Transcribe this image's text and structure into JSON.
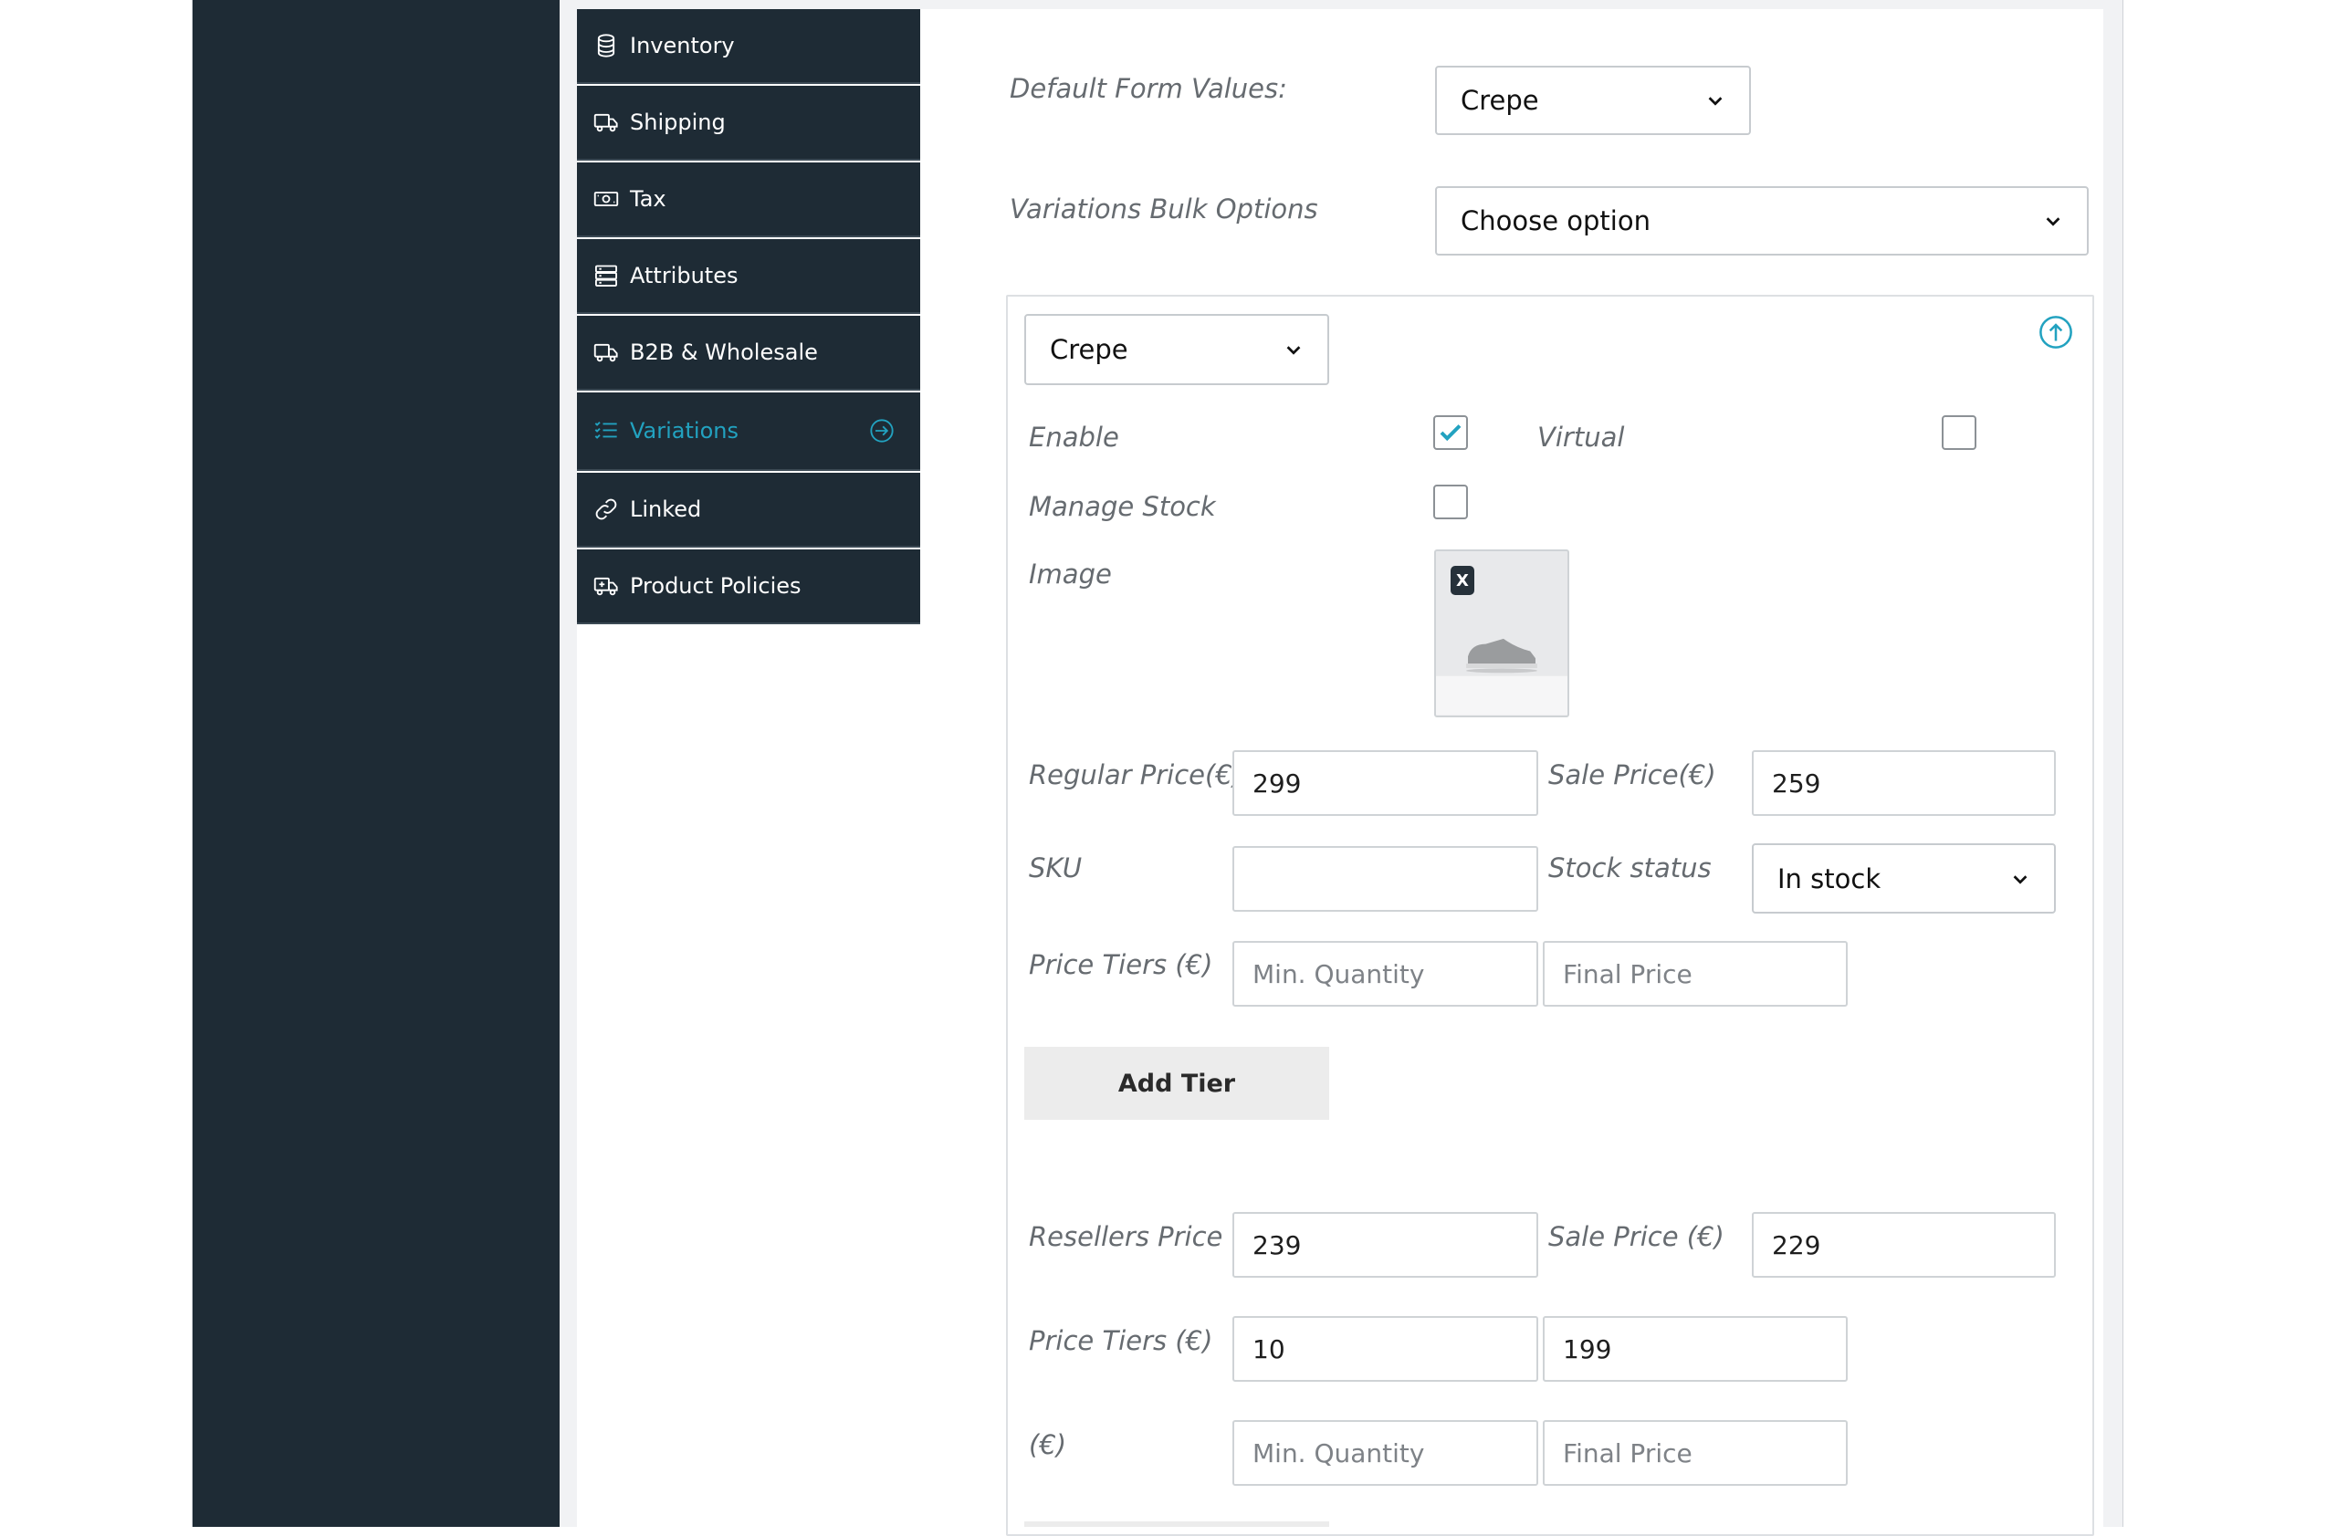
{
  "menu": {
    "items": [
      {
        "label": "Inventory",
        "icon": "database-icon"
      },
      {
        "label": "Shipping",
        "icon": "truck-icon"
      },
      {
        "label": "Tax",
        "icon": "money-icon"
      },
      {
        "label": "Attributes",
        "icon": "server-icon"
      },
      {
        "label": "B2B & Wholesale",
        "icon": "truck-icon"
      },
      {
        "label": "Variations",
        "icon": "list-check-icon",
        "active": true
      },
      {
        "label": "Linked",
        "icon": "link-icon"
      },
      {
        "label": "Product Policies",
        "icon": "ambulance-icon"
      }
    ]
  },
  "form": {
    "default_form_values_label": "Default Form Values:",
    "default_form_values": "Crepe",
    "bulk_options_label": "Variations Bulk Options",
    "bulk_options_value": "Choose option"
  },
  "variation": {
    "attribute_value": "Crepe",
    "enable_label": "Enable",
    "enable_checked": true,
    "virtual_label": "Virtual",
    "virtual_checked": false,
    "manage_stock_label": "Manage Stock",
    "manage_stock_checked": false,
    "image_label": "Image",
    "image_remove": "X",
    "regular_price_label": "Regular Price(€)",
    "regular_price": "299",
    "sale_price_label": "Sale Price(€)",
    "sale_price": "259",
    "sku_label": "SKU",
    "sku": "",
    "stock_status_label": "Stock status",
    "stock_status": "In stock",
    "price_tiers_label": "Price Tiers (€)",
    "min_qty_placeholder": "Min. Quantity",
    "final_price_placeholder": "Final Price",
    "add_tier_label": "Add Tier",
    "resellers_price_label": "Resellers Price (€)",
    "resellers_price": "239",
    "resellers_sale_price_label": "Sale Price (€)",
    "resellers_sale_price": "229",
    "resellers_tiers_label": "Price Tiers (€)",
    "resellers_tier_min_qty": "10",
    "resellers_tier_final_price": "199",
    "extra_tier_label": "(€)"
  },
  "colors": {
    "sidebar": "#1e2b35",
    "accent": "#22a2c0"
  }
}
